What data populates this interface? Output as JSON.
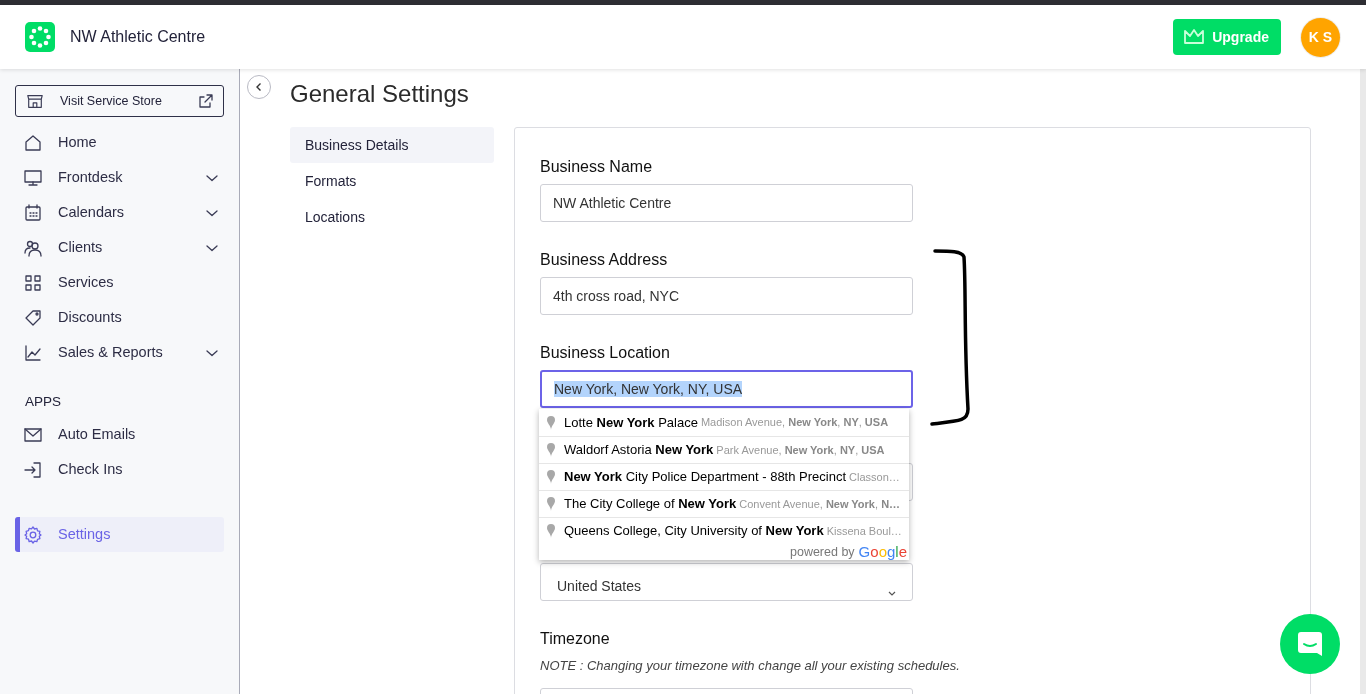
{
  "header": {
    "business_name": "NW Athletic Centre",
    "upgrade_button": "Upgrade",
    "avatar_initials": "K S"
  },
  "sidebar": {
    "store_button": "Visit Service Store",
    "items": [
      {
        "label": "Home",
        "expandable": false,
        "selected": false
      },
      {
        "label": "Frontdesk",
        "expandable": true,
        "selected": false
      },
      {
        "label": "Calendars",
        "expandable": true,
        "selected": false
      },
      {
        "label": "Clients",
        "expandable": true,
        "selected": false
      },
      {
        "label": "Services",
        "expandable": false,
        "selected": false
      },
      {
        "label": "Discounts",
        "expandable": false,
        "selected": false
      },
      {
        "label": "Sales & Reports",
        "expandable": true,
        "selected": false
      }
    ],
    "apps_heading": "APPS",
    "apps": [
      {
        "label": "Auto Emails",
        "selected": false
      },
      {
        "label": "Check Ins",
        "selected": false
      }
    ],
    "bottom_items": [
      {
        "label": "Settings",
        "selected": true
      }
    ]
  },
  "page": {
    "title": "General Settings",
    "subnav": [
      {
        "label": "Business Details",
        "selected": true
      },
      {
        "label": "Formats",
        "selected": false
      },
      {
        "label": "Locations",
        "selected": false
      }
    ],
    "fields": [
      {
        "kind": "text",
        "label": "Business Name",
        "value": "NW Athletic Centre",
        "focused": false
      },
      {
        "kind": "text",
        "label": "Business Address",
        "value": "4th cross road, NYC",
        "focused": false
      },
      {
        "kind": "text",
        "label": "Business Location",
        "value": "New York, New York, NY, USA",
        "focused": true,
        "suggestions": [
          {
            "main": "Lotte **New York** Palace",
            "secondary": "Madison Avenue, **New York**, **NY**, **USA**"
          },
          {
            "main": "Waldorf Astoria **New York**",
            "secondary": "Park Avenue, **New York**, **NY**, **USA**"
          },
          {
            "main": "**New York** City Police Department - 88th Precinct",
            "secondary": "Classon…"
          },
          {
            "main": "The City College of **New York**",
            "secondary": "Convent Avenue, **New York**, **N…**"
          },
          {
            "main": "Queens College, City University of **New York**",
            "secondary": "Kissena Boul…"
          }
        ],
        "attribution": {
          "text": "powered by",
          "brand": "Google"
        }
      },
      {
        "kind": "blank"
      },
      {
        "kind": "select",
        "value": "United States"
      },
      {
        "kind": "text",
        "label": "Timezone",
        "note": "NOTE : Changing your timezone with change all your existing schedules."
      }
    ]
  }
}
